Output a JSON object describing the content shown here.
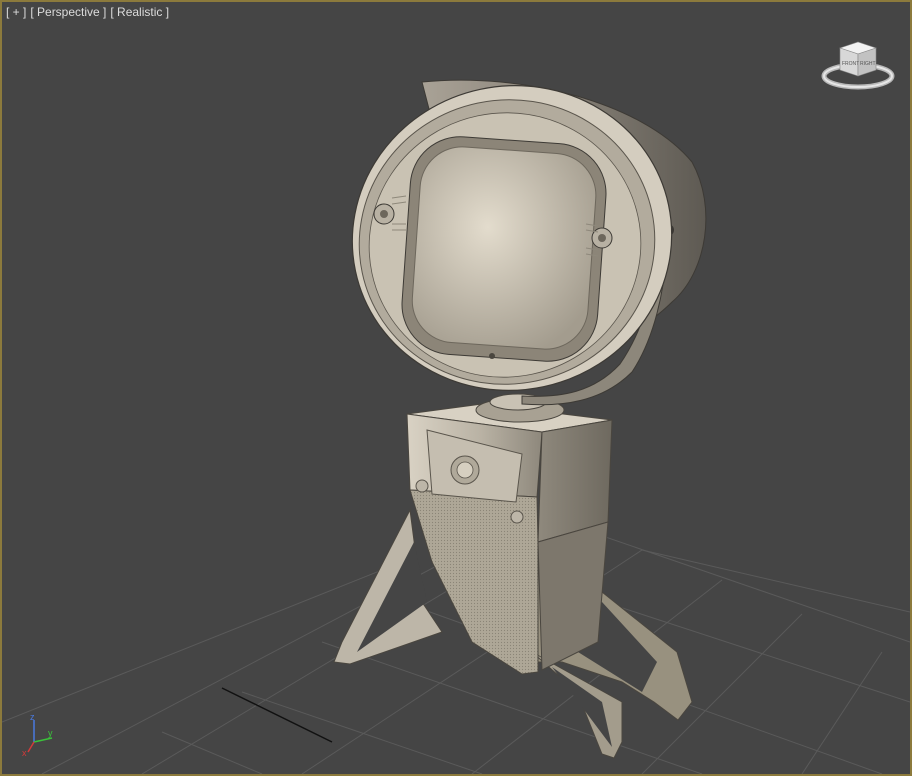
{
  "viewport": {
    "labels": {
      "plus": "[ + ]",
      "view": "[ Perspective ]",
      "shading": "[ Realistic ]"
    },
    "active_border_color": "#8c7a3c",
    "background_color": "#454545"
  },
  "viewcube": {
    "front_label": "FRONT",
    "right_label": "RIGHT"
  },
  "axis_gizmo": {
    "x": "x",
    "y": "y",
    "z": "z",
    "colors": {
      "x": "#d23a3a",
      "y": "#3ac23a",
      "z": "#4a7ae0"
    }
  },
  "model": {
    "name_icon": "retro-television-robot-model",
    "material_color": "#cbc3b4"
  }
}
